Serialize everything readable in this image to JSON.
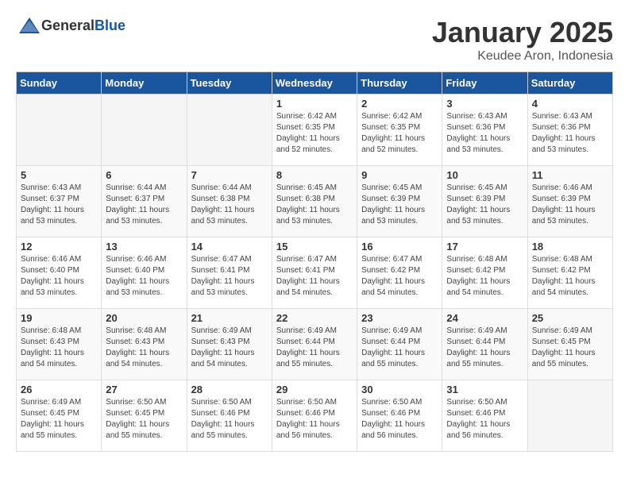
{
  "header": {
    "logo_general": "General",
    "logo_blue": "Blue",
    "title": "January 2025",
    "subtitle": "Keudee Aron, Indonesia"
  },
  "days_of_week": [
    "Sunday",
    "Monday",
    "Tuesday",
    "Wednesday",
    "Thursday",
    "Friday",
    "Saturday"
  ],
  "weeks": [
    [
      {
        "day": "",
        "info": ""
      },
      {
        "day": "",
        "info": ""
      },
      {
        "day": "",
        "info": ""
      },
      {
        "day": "1",
        "info": "Sunrise: 6:42 AM\nSunset: 6:35 PM\nDaylight: 11 hours\nand 52 minutes."
      },
      {
        "day": "2",
        "info": "Sunrise: 6:42 AM\nSunset: 6:35 PM\nDaylight: 11 hours\nand 52 minutes."
      },
      {
        "day": "3",
        "info": "Sunrise: 6:43 AM\nSunset: 6:36 PM\nDaylight: 11 hours\nand 53 minutes."
      },
      {
        "day": "4",
        "info": "Sunrise: 6:43 AM\nSunset: 6:36 PM\nDaylight: 11 hours\nand 53 minutes."
      }
    ],
    [
      {
        "day": "5",
        "info": "Sunrise: 6:43 AM\nSunset: 6:37 PM\nDaylight: 11 hours\nand 53 minutes."
      },
      {
        "day": "6",
        "info": "Sunrise: 6:44 AM\nSunset: 6:37 PM\nDaylight: 11 hours\nand 53 minutes."
      },
      {
        "day": "7",
        "info": "Sunrise: 6:44 AM\nSunset: 6:38 PM\nDaylight: 11 hours\nand 53 minutes."
      },
      {
        "day": "8",
        "info": "Sunrise: 6:45 AM\nSunset: 6:38 PM\nDaylight: 11 hours\nand 53 minutes."
      },
      {
        "day": "9",
        "info": "Sunrise: 6:45 AM\nSunset: 6:39 PM\nDaylight: 11 hours\nand 53 minutes."
      },
      {
        "day": "10",
        "info": "Sunrise: 6:45 AM\nSunset: 6:39 PM\nDaylight: 11 hours\nand 53 minutes."
      },
      {
        "day": "11",
        "info": "Sunrise: 6:46 AM\nSunset: 6:39 PM\nDaylight: 11 hours\nand 53 minutes."
      }
    ],
    [
      {
        "day": "12",
        "info": "Sunrise: 6:46 AM\nSunset: 6:40 PM\nDaylight: 11 hours\nand 53 minutes."
      },
      {
        "day": "13",
        "info": "Sunrise: 6:46 AM\nSunset: 6:40 PM\nDaylight: 11 hours\nand 53 minutes."
      },
      {
        "day": "14",
        "info": "Sunrise: 6:47 AM\nSunset: 6:41 PM\nDaylight: 11 hours\nand 53 minutes."
      },
      {
        "day": "15",
        "info": "Sunrise: 6:47 AM\nSunset: 6:41 PM\nDaylight: 11 hours\nand 54 minutes."
      },
      {
        "day": "16",
        "info": "Sunrise: 6:47 AM\nSunset: 6:42 PM\nDaylight: 11 hours\nand 54 minutes."
      },
      {
        "day": "17",
        "info": "Sunrise: 6:48 AM\nSunset: 6:42 PM\nDaylight: 11 hours\nand 54 minutes."
      },
      {
        "day": "18",
        "info": "Sunrise: 6:48 AM\nSunset: 6:42 PM\nDaylight: 11 hours\nand 54 minutes."
      }
    ],
    [
      {
        "day": "19",
        "info": "Sunrise: 6:48 AM\nSunset: 6:43 PM\nDaylight: 11 hours\nand 54 minutes."
      },
      {
        "day": "20",
        "info": "Sunrise: 6:48 AM\nSunset: 6:43 PM\nDaylight: 11 hours\nand 54 minutes."
      },
      {
        "day": "21",
        "info": "Sunrise: 6:49 AM\nSunset: 6:43 PM\nDaylight: 11 hours\nand 54 minutes."
      },
      {
        "day": "22",
        "info": "Sunrise: 6:49 AM\nSunset: 6:44 PM\nDaylight: 11 hours\nand 55 minutes."
      },
      {
        "day": "23",
        "info": "Sunrise: 6:49 AM\nSunset: 6:44 PM\nDaylight: 11 hours\nand 55 minutes."
      },
      {
        "day": "24",
        "info": "Sunrise: 6:49 AM\nSunset: 6:44 PM\nDaylight: 11 hours\nand 55 minutes."
      },
      {
        "day": "25",
        "info": "Sunrise: 6:49 AM\nSunset: 6:45 PM\nDaylight: 11 hours\nand 55 minutes."
      }
    ],
    [
      {
        "day": "26",
        "info": "Sunrise: 6:49 AM\nSunset: 6:45 PM\nDaylight: 11 hours\nand 55 minutes."
      },
      {
        "day": "27",
        "info": "Sunrise: 6:50 AM\nSunset: 6:45 PM\nDaylight: 11 hours\nand 55 minutes."
      },
      {
        "day": "28",
        "info": "Sunrise: 6:50 AM\nSunset: 6:46 PM\nDaylight: 11 hours\nand 55 minutes."
      },
      {
        "day": "29",
        "info": "Sunrise: 6:50 AM\nSunset: 6:46 PM\nDaylight: 11 hours\nand 56 minutes."
      },
      {
        "day": "30",
        "info": "Sunrise: 6:50 AM\nSunset: 6:46 PM\nDaylight: 11 hours\nand 56 minutes."
      },
      {
        "day": "31",
        "info": "Sunrise: 6:50 AM\nSunset: 6:46 PM\nDaylight: 11 hours\nand 56 minutes."
      },
      {
        "day": "",
        "info": ""
      }
    ]
  ]
}
